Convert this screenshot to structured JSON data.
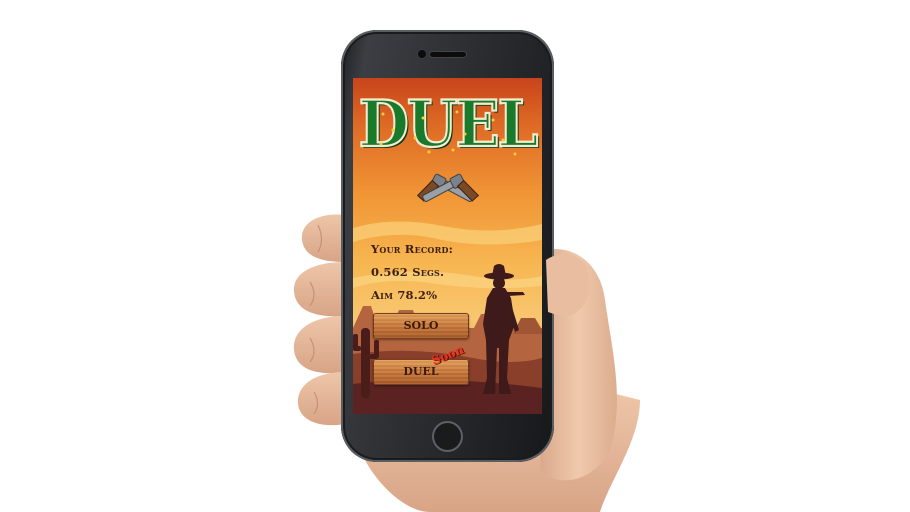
{
  "game": {
    "title": "DUEL",
    "record": {
      "heading": "Your Record:",
      "time": "0.562 Segs.",
      "aim": "Aim 78.2%"
    },
    "buttons": {
      "solo": "SOLO",
      "duel": "DUEL"
    },
    "soon_badge": "Soon"
  },
  "icons": {
    "revolvers": "crossed-revolvers-icon",
    "cowboy": "cowboy-silhouette",
    "cactus": "cactus-silhouette"
  },
  "colors": {
    "title_green": "#1a7a2c",
    "title_star": "#f2d23a",
    "sky_top": "#c8441b",
    "sky_mid": "#f7b651",
    "ground": "#6a2c24",
    "wood": "#c9783a",
    "soon_red": "#e8321e",
    "phone_body": "#2a2c30"
  }
}
